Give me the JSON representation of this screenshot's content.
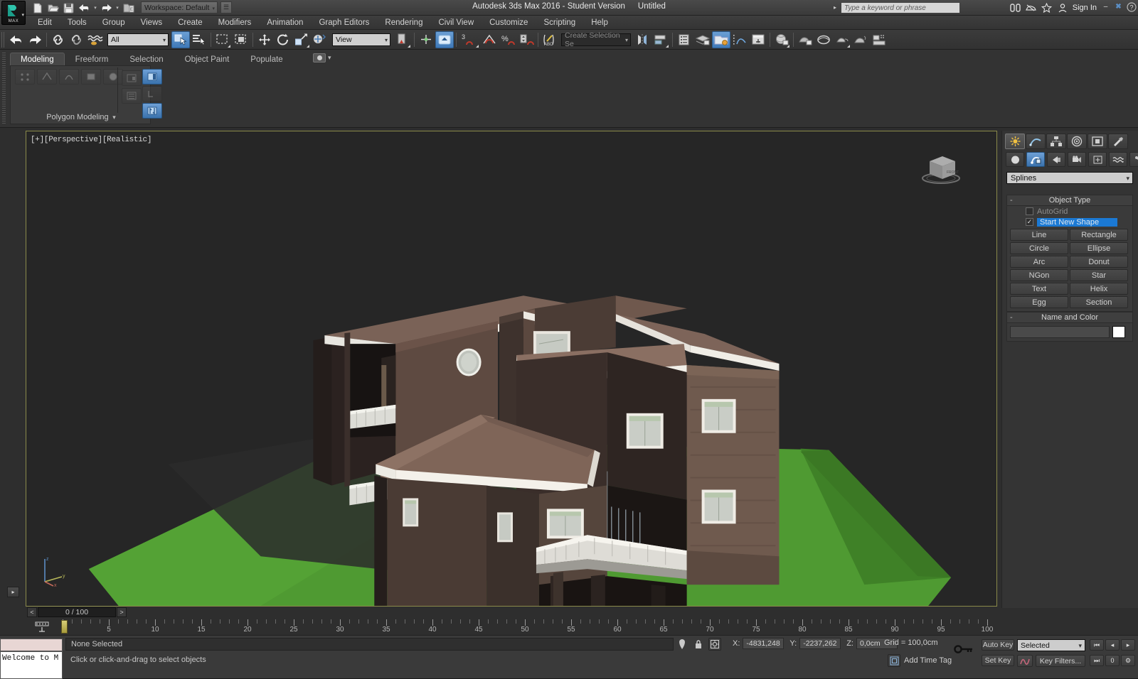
{
  "window": {
    "title": "Autodesk 3ds Max 2016 - Student Version",
    "document": "Untitled",
    "minimize": "–",
    "maximize": "✖",
    "help": "?",
    "signin": "Sign In"
  },
  "quick_access": {
    "workspace_label": "Workspace: Default",
    "items": [
      "new-file-icon",
      "open-file-icon",
      "save-file-icon",
      "undo-icon",
      "redo-icon",
      "set-project-folder-icon"
    ]
  },
  "search": {
    "placeholder": "Type a keyword or phrase"
  },
  "menu": {
    "items": [
      "Edit",
      "Tools",
      "Group",
      "Views",
      "Create",
      "Modifiers",
      "Animation",
      "Graph Editors",
      "Rendering",
      "Civil View",
      "Customize",
      "Scripting",
      "Help"
    ]
  },
  "toolbar": {
    "selection_filter": "All",
    "reference_coord": "View",
    "named_selection_sets": "Create Selection Se",
    "snap_toggle_label": "3"
  },
  "ribbon": {
    "tabs": [
      "Modeling",
      "Freeform",
      "Selection",
      "Object Paint",
      "Populate"
    ],
    "active_tab": "Modeling",
    "panel_label": "Polygon Modeling"
  },
  "viewport": {
    "label": "[+][Perspective][Realistic]",
    "label_parts": [
      "[+]",
      "[Perspective]",
      "[Realistic]"
    ]
  },
  "command_panel": {
    "tabs": [
      "create-tab",
      "modify-tab",
      "hierarchy-tab",
      "motion-tab",
      "display-tab",
      "utilities-tab"
    ],
    "active_tab": "create-tab",
    "object_categories": [
      "geometry-icon",
      "shapes-icon",
      "lights-icon",
      "cameras-icon",
      "helpers-icon",
      "space-warps-icon",
      "systems-icon"
    ],
    "active_category": "shapes-icon",
    "category_dropdown": "Splines",
    "rollouts": {
      "object_type": {
        "title": "Object Type",
        "collapse": "-",
        "autogrid_label": "AutoGrid",
        "autogrid_checked": false,
        "start_new_shape_label": "Start New Shape",
        "start_new_shape_checked": true,
        "buttons": [
          "Line",
          "Rectangle",
          "Circle",
          "Ellipse",
          "Arc",
          "Donut",
          "NGon",
          "Star",
          "Text",
          "Helix",
          "Egg",
          "Section"
        ]
      },
      "name_and_color": {
        "title": "Name and Color",
        "collapse": "-",
        "name_value": "",
        "color": "#ffffff"
      }
    }
  },
  "time_slider": {
    "current": "0 / 100",
    "prev": "<",
    "next": ">"
  },
  "track_bar": {
    "ticks": [
      5,
      10,
      15,
      20,
      25,
      30,
      35,
      40,
      45,
      50,
      55,
      60,
      65,
      70,
      75,
      80,
      85,
      90,
      95,
      100
    ]
  },
  "status_bar": {
    "listener_text": "Welcome to M",
    "selection_status": "None Selected",
    "prompt": "Click or click-and-drag to select objects",
    "coords": {
      "x_label": "X:",
      "x_value": "-4831,248",
      "y_label": "Y:",
      "y_value": "-2237,262",
      "z_label": "Z:",
      "z_value": "0,0cm"
    },
    "grid": "Grid = 100,0cm",
    "add_time_tag": "Add Time Tag"
  },
  "animation": {
    "auto_key": "Auto Key",
    "set_key": "Set Key",
    "key_mode": "Selected",
    "key_filters": "Key Filters...",
    "nav": [
      "go-to-start",
      "previous-frame",
      "next-frame",
      "go-to-end"
    ]
  },
  "scene": {
    "description": "Three-story brick house model on a green terrain plane",
    "colors": {
      "viewport_bg": "#262626",
      "ground_green": "#4f9a32",
      "ground_green_dark": "#3c7a26",
      "brick_light": "#6a564c",
      "brick_mid": "#55443c",
      "brick_dark": "#392d29",
      "brick_shadow": "#2b2220",
      "roof_light": "#8a6f62",
      "roof_mid": "#715a50",
      "roof_dark": "#5b483f",
      "trim_white": "#e8e6e0",
      "window_glass": "#c9cdc6",
      "window_tint": "#b7c7ad",
      "accent_blue": "#3a72ad",
      "viewport_border": "#8a8a4a"
    }
  }
}
